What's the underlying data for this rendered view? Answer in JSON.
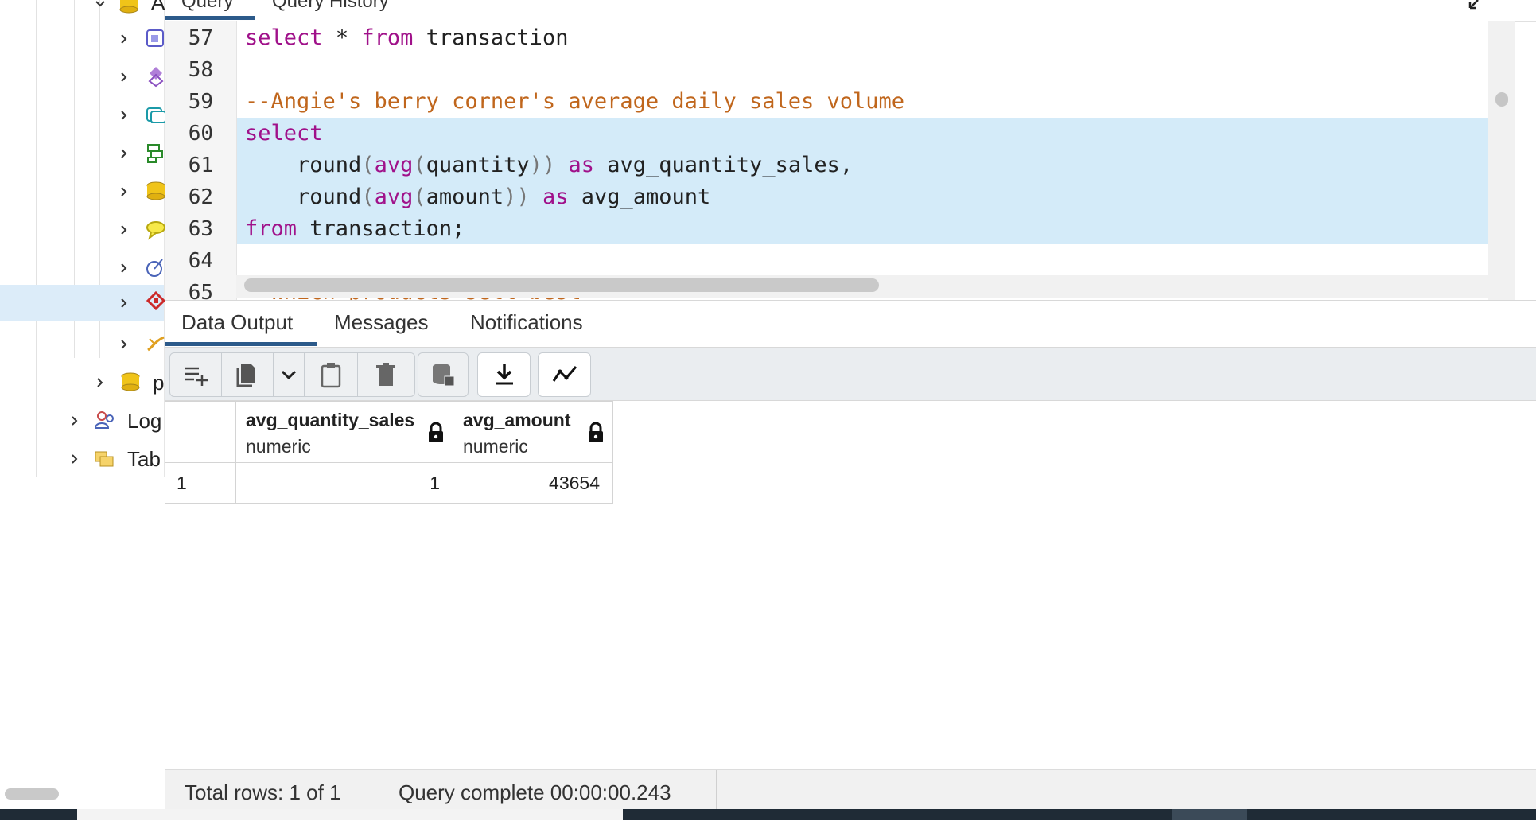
{
  "tree": {
    "items": [
      {
        "label": "A",
        "icon": "database-icon"
      },
      {
        "label": "",
        "icon": "collation-icon"
      },
      {
        "label": "",
        "icon": "domain-icon"
      },
      {
        "label": "",
        "icon": "ftsconfig-icon"
      },
      {
        "label": "",
        "icon": "fts-parser-icon"
      },
      {
        "label": "",
        "icon": "foreign-table-icon"
      },
      {
        "label": "",
        "icon": "comment-icon"
      },
      {
        "label": "",
        "icon": "event-trigger-icon"
      },
      {
        "label": "",
        "icon": "extension-icon"
      },
      {
        "label": "",
        "icon": "language-icon"
      },
      {
        "label": "p",
        "icon": "database-icon"
      },
      {
        "label": "Log",
        "icon": "login-roles-icon"
      },
      {
        "label": "Tab",
        "icon": "tablespaces-icon"
      }
    ]
  },
  "editor": {
    "tabs": [
      "Query",
      "Query History"
    ],
    "lines": [
      {
        "n": "57",
        "text": "select * from transaction"
      },
      {
        "n": "58",
        "text": ""
      },
      {
        "n": "59",
        "text": "--Angie's berry corner's average daily sales volume"
      },
      {
        "n": "60",
        "text": "select"
      },
      {
        "n": "61",
        "text": "    round(avg(quantity)) as avg_quantity_sales,"
      },
      {
        "n": "62",
        "text": "    round(avg(amount)) as avg_amount"
      },
      {
        "n": "63",
        "text": "from transaction;"
      },
      {
        "n": "64",
        "text": ""
      },
      {
        "n": "65",
        "text": "--Which products sell best"
      }
    ]
  },
  "results": {
    "tabs": [
      "Data Output",
      "Messages",
      "Notifications"
    ],
    "active_tab": "Data Output",
    "toolbar": [
      "add-row-icon",
      "copy-icon",
      "copy-options-chevron-icon",
      "paste-icon",
      "delete-icon",
      "save-data-icon",
      "download-icon",
      "graph-visualiser-icon"
    ],
    "columns": [
      {
        "name": "avg_quantity_sales",
        "type": "numeric"
      },
      {
        "name": "avg_amount",
        "type": "numeric"
      }
    ],
    "rows": [
      {
        "index": "1",
        "values": [
          "1",
          "43654"
        ]
      }
    ],
    "status": {
      "rows": "Total rows: 1 of 1",
      "query": "Query complete 00:00:00.243"
    }
  },
  "colors": {
    "accent": "#2c5a8a",
    "selection": "#d4ebf9",
    "keyword": "#a0118a",
    "comment": "#c0661c"
  }
}
